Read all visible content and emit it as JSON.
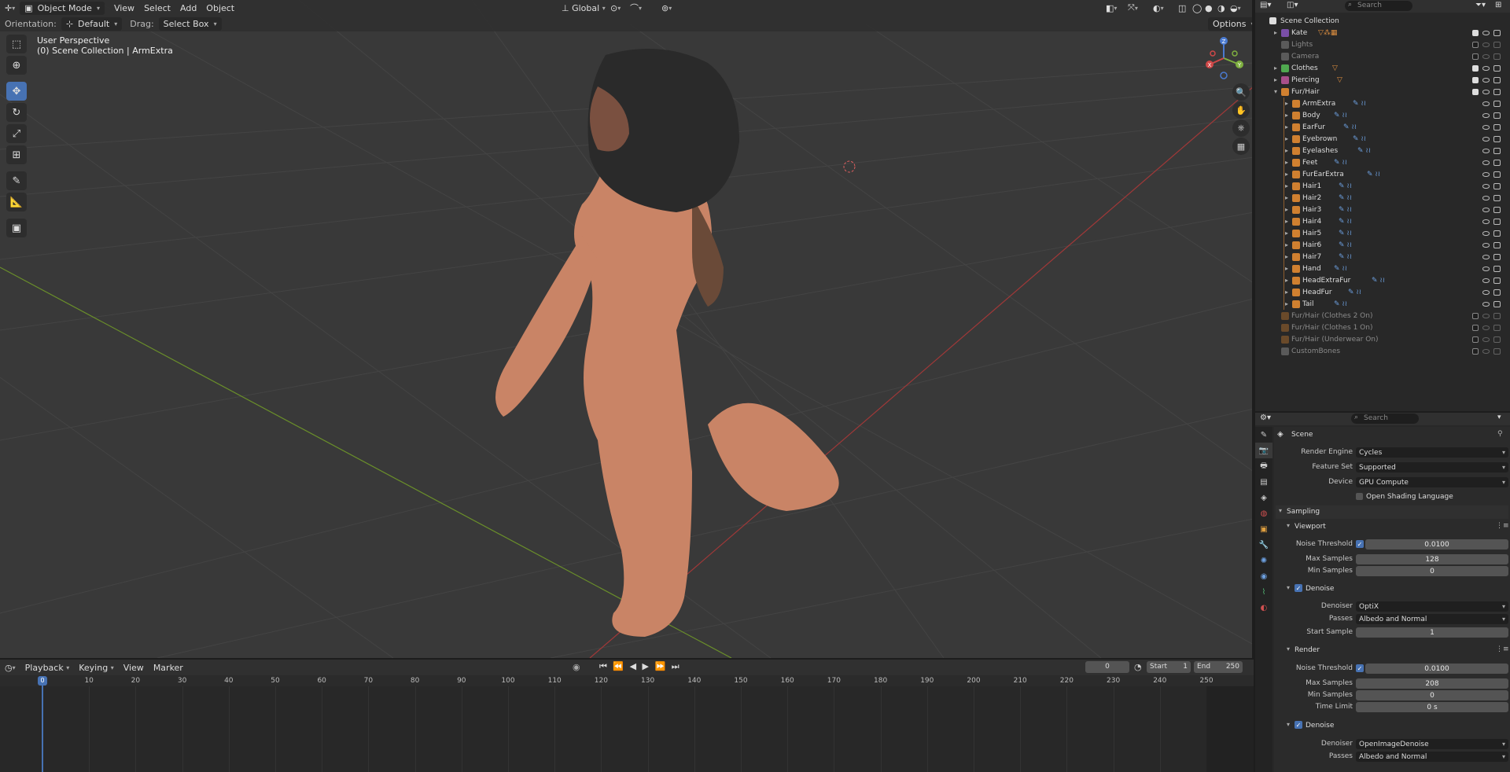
{
  "header": {
    "mode": "Object Mode",
    "menus": [
      "View",
      "Select",
      "Add",
      "Object"
    ],
    "orientation_label": "Orientation:",
    "orientation_value": "Default",
    "drag_label": "Drag:",
    "drag_value": "Select Box",
    "transform_orientation": "Global",
    "search_placeholder": "Search",
    "options": "Options"
  },
  "viewport": {
    "perspective": "User Perspective",
    "collection": "(0) Scene Collection | ArmExtra"
  },
  "timeline": {
    "menus": [
      "Playback",
      "Keying",
      "View",
      "Marker"
    ],
    "current_frame": "0",
    "start_label": "Start",
    "start": "1",
    "end_label": "End",
    "end": "250",
    "ruler": [
      "0",
      "10",
      "20",
      "30",
      "40",
      "50",
      "60",
      "70",
      "80",
      "90",
      "100",
      "110",
      "120",
      "130",
      "140",
      "150",
      "160",
      "170",
      "180",
      "190",
      "200",
      "210",
      "220",
      "230",
      "240",
      "250"
    ]
  },
  "outliner": {
    "search_placeholder": "Search",
    "root": "Scene Collection",
    "items": [
      {
        "name": "Kate",
        "level": 0,
        "color": "#7a4fa8",
        "expand": "▸",
        "enabled": true
      },
      {
        "name": "Lights",
        "level": 0,
        "color": "#5a5a5a",
        "expand": "",
        "enabled": false
      },
      {
        "name": "Camera",
        "level": 0,
        "color": "#5a5a5a",
        "expand": "",
        "enabled": false
      },
      {
        "name": "Clothes",
        "level": 0,
        "color": "#4fa84f",
        "expand": "▸",
        "enabled": true
      },
      {
        "name": "Piercing",
        "level": 0,
        "color": "#a84f8a",
        "expand": "▸",
        "enabled": true
      },
      {
        "name": "Fur/Hair",
        "level": 0,
        "color": "#d08030",
        "expand": "▾",
        "enabled": true
      },
      {
        "name": "ArmExtra",
        "level": 1,
        "color": "#d08030",
        "expand": "▸",
        "enabled": true
      },
      {
        "name": "Body",
        "level": 1,
        "color": "#d08030",
        "expand": "▸",
        "enabled": true
      },
      {
        "name": "EarFur",
        "level": 1,
        "color": "#d08030",
        "expand": "▸",
        "enabled": true
      },
      {
        "name": "Eyebrown",
        "level": 1,
        "color": "#d08030",
        "expand": "▸",
        "enabled": true
      },
      {
        "name": "Eyelashes",
        "level": 1,
        "color": "#d08030",
        "expand": "▸",
        "enabled": true
      },
      {
        "name": "Feet",
        "level": 1,
        "color": "#d08030",
        "expand": "▸",
        "enabled": true
      },
      {
        "name": "FurEarExtra",
        "level": 1,
        "color": "#d08030",
        "expand": "▸",
        "enabled": true
      },
      {
        "name": "Hair1",
        "level": 1,
        "color": "#d08030",
        "expand": "▸",
        "enabled": true
      },
      {
        "name": "Hair2",
        "level": 1,
        "color": "#d08030",
        "expand": "▸",
        "enabled": true
      },
      {
        "name": "Hair3",
        "level": 1,
        "color": "#d08030",
        "expand": "▸",
        "enabled": true
      },
      {
        "name": "Hair4",
        "level": 1,
        "color": "#d08030",
        "expand": "▸",
        "enabled": true
      },
      {
        "name": "Hair5",
        "level": 1,
        "color": "#d08030",
        "expand": "▸",
        "enabled": true
      },
      {
        "name": "Hair6",
        "level": 1,
        "color": "#d08030",
        "expand": "▸",
        "enabled": true
      },
      {
        "name": "Hair7",
        "level": 1,
        "color": "#d08030",
        "expand": "▸",
        "enabled": true
      },
      {
        "name": "Hand",
        "level": 1,
        "color": "#d08030",
        "expand": "▸",
        "enabled": true
      },
      {
        "name": "HeadExtraFur",
        "level": 1,
        "color": "#d08030",
        "expand": "▸",
        "enabled": true
      },
      {
        "name": "HeadFur",
        "level": 1,
        "color": "#d08030",
        "expand": "▸",
        "enabled": true
      },
      {
        "name": "Tail",
        "level": 1,
        "color": "#d08030",
        "expand": "▸",
        "enabled": true
      },
      {
        "name": "Fur/Hair (Clothes 2 On)",
        "level": 0,
        "color": "#6a4a2a",
        "expand": "",
        "enabled": false
      },
      {
        "name": "Fur/Hair (Clothes 1 On)",
        "level": 0,
        "color": "#6a4a2a",
        "expand": "",
        "enabled": false
      },
      {
        "name": "Fur/Hair (Underwear On)",
        "level": 0,
        "color": "#6a4a2a",
        "expand": "",
        "enabled": false
      },
      {
        "name": "CustomBones",
        "level": 0,
        "color": "#5a5a5a",
        "expand": "",
        "enabled": false
      }
    ]
  },
  "properties": {
    "search_placeholder": "Search",
    "context": "Scene",
    "render_engine_label": "Render Engine",
    "render_engine": "Cycles",
    "feature_set_label": "Feature Set",
    "feature_set": "Supported",
    "device_label": "Device",
    "device": "GPU Compute",
    "osl_label": "Open Shading Language",
    "sampling": "Sampling",
    "viewport": "Viewport",
    "noise_threshold_label": "Noise Threshold",
    "vp_noise": "0.0100",
    "max_samples_label": "Max Samples",
    "vp_max": "128",
    "min_samples_label": "Min Samples",
    "vp_min": "0",
    "denoise": "Denoise",
    "denoiser_label": "Denoiser",
    "vp_denoiser": "OptiX",
    "passes_label": "Passes",
    "vp_passes": "Albedo and Normal",
    "start_sample_label": "Start Sample",
    "vp_start": "1",
    "render": "Render",
    "r_noise": "0.0100",
    "r_max": "208",
    "r_min": "0",
    "time_limit_label": "Time Limit",
    "r_time": "0 s",
    "r_denoiser": "OpenImageDenoise",
    "r_passes": "Albedo and Normal"
  }
}
